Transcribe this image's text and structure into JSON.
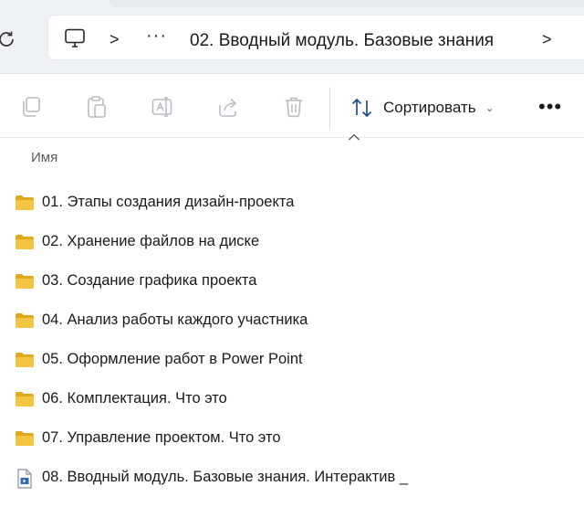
{
  "address": {
    "location_icon": "computer-icon",
    "separator": ">",
    "overflow": "···",
    "current_folder": "02. Вводный модуль. Базовые знания",
    "end_chevron": ">"
  },
  "toolbar": {
    "buttons": [
      {
        "name": "copy-icon"
      },
      {
        "name": "paste-icon"
      },
      {
        "name": "rename-icon"
      },
      {
        "name": "share-icon"
      },
      {
        "name": "delete-icon"
      }
    ],
    "sort_label": "Сортировать",
    "sort_caret": "⌄",
    "more_label": "•••"
  },
  "list": {
    "column_name": "Имя",
    "items": [
      {
        "label": "01. Этапы создания дизайн-проекта",
        "type": "folder"
      },
      {
        "label": "02. Хранение файлов на диске",
        "type": "folder"
      },
      {
        "label": "03. Создание графика проекта",
        "type": "folder"
      },
      {
        "label": "04. Анализ работы каждого участника",
        "type": "folder"
      },
      {
        "label": "05. Оформление работ в Power Point",
        "type": "folder"
      },
      {
        "label": "06. Комплектация. Что это",
        "type": "folder"
      },
      {
        "label": "07. Управление проектом. Что это",
        "type": "folder"
      },
      {
        "label": "08. Вводный модуль. Базовые знания. Интерактив _",
        "type": "file"
      }
    ]
  },
  "colors": {
    "folder": "#f4c542",
    "folder_dark": "#e2a81c",
    "icon_gray": "#b8bcc4",
    "accent": "#2b6cb0"
  }
}
